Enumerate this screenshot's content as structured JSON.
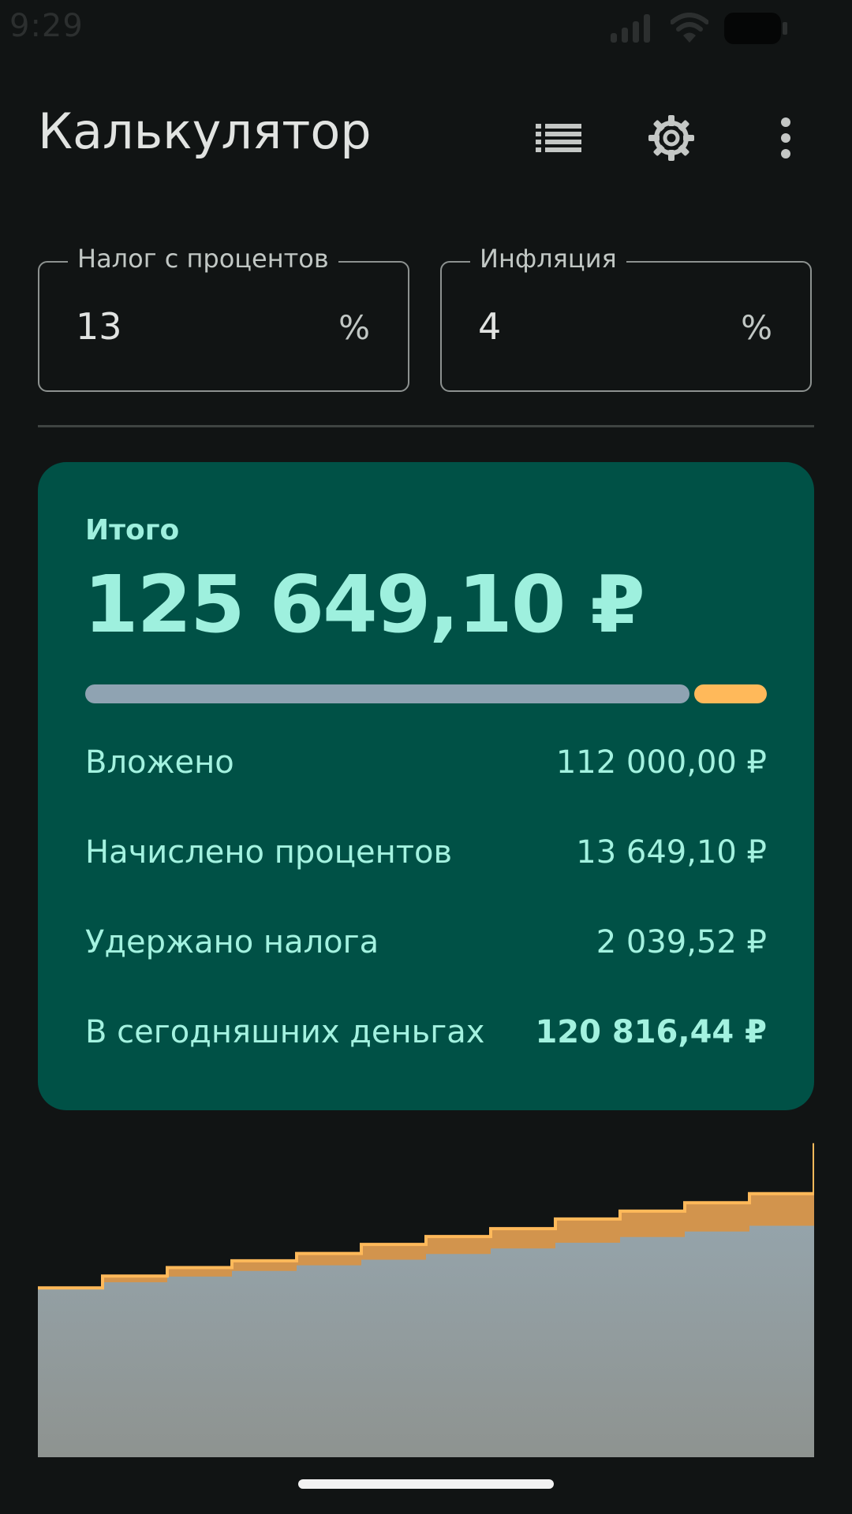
{
  "status_bar": {
    "time": "9:29"
  },
  "app_bar": {
    "title": "Калькулятор",
    "actions": [
      "list-icon",
      "settings-icon",
      "more-vert-icon"
    ]
  },
  "fields": {
    "tax": {
      "label": "Налог с процентов",
      "value": "13",
      "suffix": "%"
    },
    "inflation": {
      "label": "Инфляция",
      "value": "4",
      "suffix": "%"
    }
  },
  "summary": {
    "total_label": "Итого",
    "total_value": "125 649,10 ₽",
    "progress": {
      "invested_fraction": 0.891,
      "interest_fraction": 0.109
    },
    "rows": [
      {
        "label": "Вложено",
        "value": "112 000,00 ₽"
      },
      {
        "label": "Начислено процентов",
        "value": "13 649,10 ₽"
      },
      {
        "label": "Удержано налога",
        "value": "2 039,52 ₽"
      },
      {
        "label": "В сегодняшних деньгах",
        "value": "120 816,44 ₽"
      }
    ]
  },
  "chart_data": {
    "type": "area",
    "x": [
      0,
      1,
      2,
      3,
      4,
      5,
      6,
      7,
      8,
      9,
      10,
      11,
      12
    ],
    "series": [
      {
        "values": [
          100000,
          101000,
          102000,
          103000,
          104000,
          105000,
          106000,
          107000,
          108000,
          109000,
          110000,
          111000,
          112000
        ]
      },
      {
        "values": [
          100000,
          102100,
          103600,
          104800,
          106100,
          107700,
          109100,
          110500,
          112200,
          113600,
          115100,
          116700,
          125649.1
        ]
      }
    ],
    "ylim": [
      70000,
      127000
    ]
  },
  "colors": {
    "background": "#111414",
    "card": "#005146",
    "accent": "#9ef0de",
    "invested": "#8fa3b2",
    "interest": "#ffb95a"
  }
}
